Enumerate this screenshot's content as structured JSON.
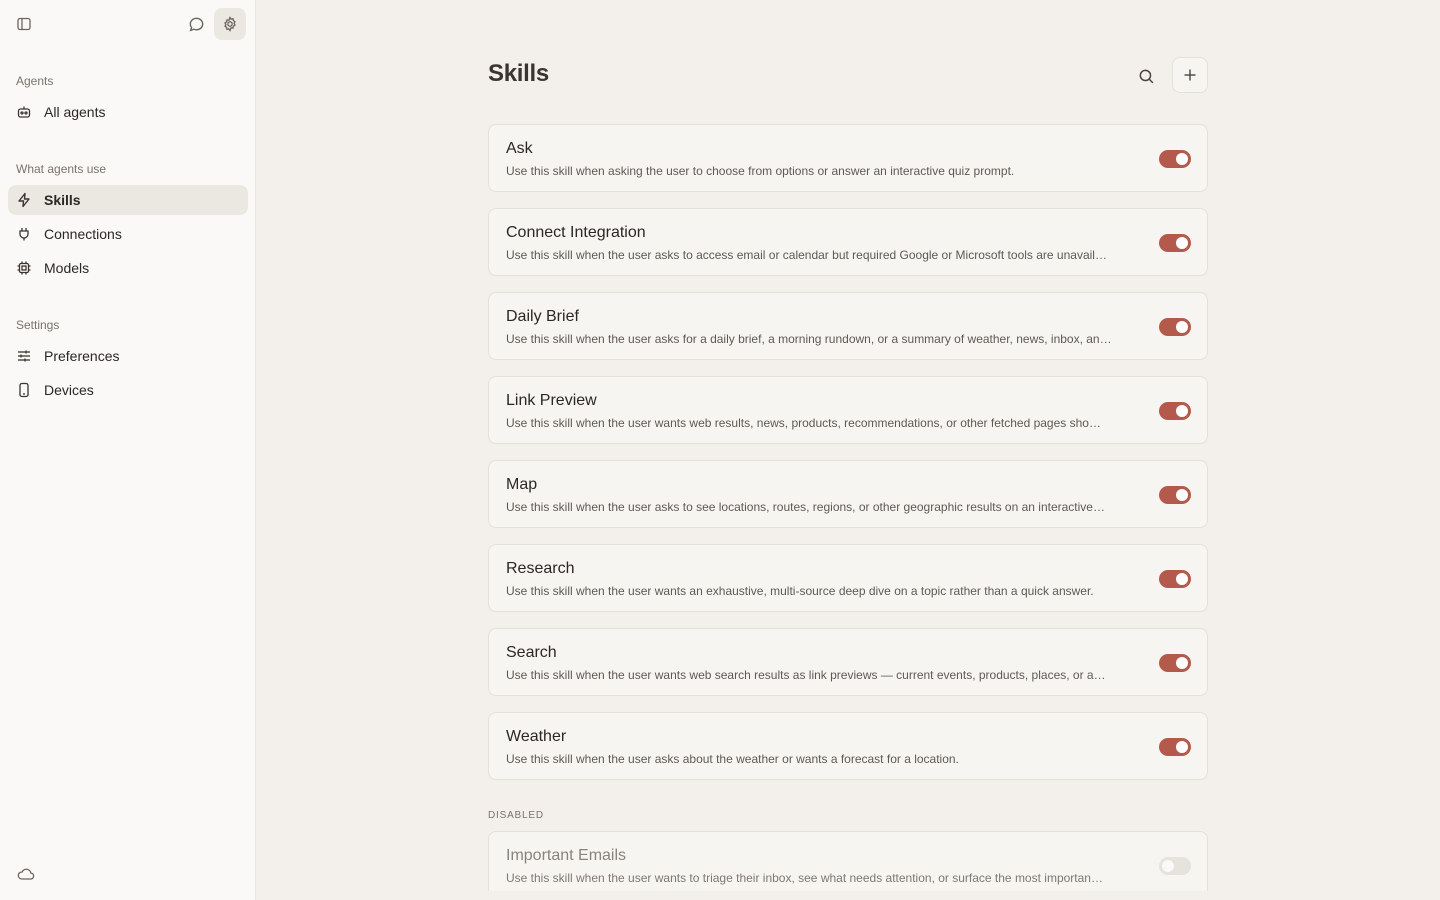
{
  "sidebar": {
    "sections": {
      "agents": "Agents",
      "what_agents_use": "What agents use",
      "settings": "Settings"
    },
    "items": {
      "all_agents": "All agents",
      "skills": "Skills",
      "connections": "Connections",
      "models": "Models",
      "preferences": "Preferences",
      "devices": "Devices"
    }
  },
  "main": {
    "title": "Skills",
    "disabled_label": "DISABLED",
    "skills": [
      {
        "name": "Ask",
        "desc": "Use this skill when asking the user to choose from options or answer an interactive quiz prompt.",
        "enabled": true
      },
      {
        "name": "Connect Integration",
        "desc": "Use this skill when the user asks to access email or calendar but required Google or Microsoft tools are unavail…",
        "enabled": true
      },
      {
        "name": "Daily Brief",
        "desc": "Use this skill when the user asks for a daily brief, a morning rundown, or a summary of weather, news, inbox, an…",
        "enabled": true
      },
      {
        "name": "Link Preview",
        "desc": "Use this skill when the user wants web results, news, products, recommendations, or other fetched pages sho…",
        "enabled": true
      },
      {
        "name": "Map",
        "desc": "Use this skill when the user asks to see locations, routes, regions, or other geographic results on an interactive…",
        "enabled": true
      },
      {
        "name": "Research",
        "desc": "Use this skill when the user wants an exhaustive, multi-source deep dive on a topic rather than a quick answer.",
        "enabled": true
      },
      {
        "name": "Search",
        "desc": "Use this skill when the user wants web search results as link previews — current events, products, places, or a…",
        "enabled": true
      },
      {
        "name": "Weather",
        "desc": "Use this skill when the user asks about the weather or wants a forecast for a location.",
        "enabled": true
      }
    ],
    "disabled_skills": [
      {
        "name": "Important Emails",
        "desc": "Use this skill when the user wants to triage their inbox, see what needs attention, or surface the most importan…",
        "enabled": false
      }
    ]
  },
  "colors": {
    "accent": "#b35a4c",
    "background": "#f3f0eb",
    "sidebar": "#faf9f7"
  },
  "icons": {
    "sidebar_toggle": "sidebar-icon",
    "chat": "chat-bubble-icon",
    "settings": "gear-icon",
    "all_agents": "robot-icon",
    "skills": "lightning-icon",
    "connections": "plug-icon",
    "models": "chip-icon",
    "preferences": "sliders-icon",
    "devices": "phone-icon",
    "cloud": "cloud-icon",
    "search": "search-icon",
    "add": "plus-icon"
  }
}
